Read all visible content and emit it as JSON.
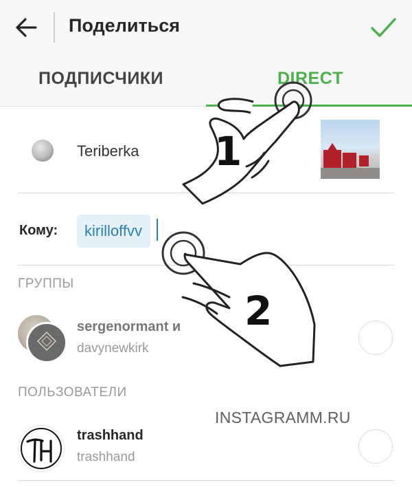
{
  "header": {
    "title": "Поделиться",
    "back_icon": "arrow-left-icon",
    "confirm_icon": "check-icon",
    "accent": "#4cb04c"
  },
  "tabs": [
    {
      "label": "ПОДПИСЧИКИ",
      "active": false
    },
    {
      "label": "DIRECT",
      "active": true
    }
  ],
  "post": {
    "location": "Teriberka"
  },
  "recipient": {
    "label": "Кому:",
    "value": "kirilloffvv"
  },
  "groups": {
    "header": "ГРУППЫ",
    "items": [
      {
        "name": "sergenormant и",
        "members": "davynewkirk"
      }
    ]
  },
  "users": {
    "header": "ПОЛЬЗОВАТЕЛИ",
    "items": [
      {
        "name": "trashhand",
        "username": "trashhand",
        "avatar_text": "TH"
      }
    ]
  },
  "overlay": {
    "steps": [
      "1",
      "2"
    ],
    "watermark": "INSTAGRAMM.RU"
  }
}
